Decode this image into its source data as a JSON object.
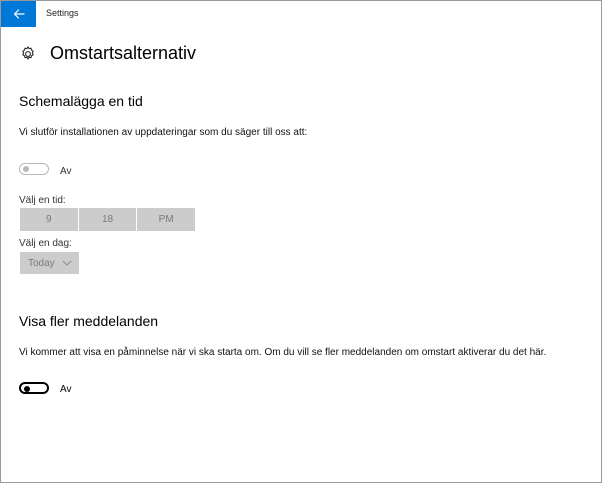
{
  "window": {
    "title": "Settings"
  },
  "page": {
    "title": "Omstartsalternativ"
  },
  "schedule": {
    "heading": "Schemalägga en tid",
    "description": "Vi slutför installationen av uppdateringar som du säger till oss att:",
    "toggle_label": "Av",
    "toggle_state": "off",
    "time_label": "Välj en tid:",
    "time": {
      "hour": "9",
      "minute": "18",
      "period": "PM"
    },
    "day_label": "Välj en dag:",
    "day_value": "Today"
  },
  "notifications": {
    "heading": "Visa fler meddelanden",
    "description": "Vi kommer att visa en påminnelse när vi ska starta om. Om du vill se fler meddelanden om omstart aktiverar du det här.",
    "toggle_label": "Av",
    "toggle_state": "off"
  },
  "colors": {
    "accent": "#0078d7",
    "disabled_fill": "#cccccc",
    "disabled_text": "#7a7a7a"
  },
  "icons": {
    "back": "arrow-left-icon",
    "settings": "gear-icon",
    "dropdown": "chevron-down-icon"
  }
}
